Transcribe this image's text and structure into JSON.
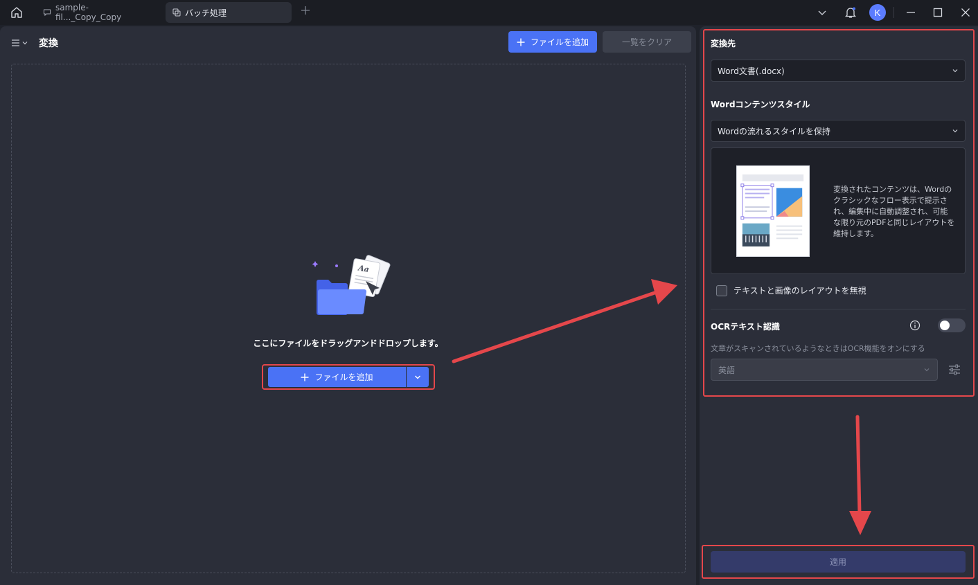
{
  "titlebar": {
    "tabs": [
      {
        "label": "sample-fil..._Copy_Copy"
      },
      {
        "label": "バッチ処理"
      }
    ],
    "avatar_initial": "K"
  },
  "left_panel": {
    "title": "変換",
    "add_file_label": "ファイルを追加",
    "clear_list_label": "一覧をクリア",
    "dropzone_text": "ここにファイルをドラッグアンドドロップします。",
    "dropzone_add_label": "ファイルを追加",
    "illustration_text": "Aa"
  },
  "right_panel": {
    "output_label": "変換先",
    "output_value": "Word文書(.docx)",
    "style_label": "Wordコンテンツスタイル",
    "style_value": "Wordの流れるスタイルを保持",
    "style_description": "変換されたコンテンツは、Wordのクラシックなフロー表示で提示され、編集中に自動調整され、可能な限り元のPDFと同じレイアウトを維持します。",
    "ignore_layout_label": "テキストと画像のレイアウトを無視",
    "ignore_layout_checked": false,
    "ocr_label": "OCRテキスト認識",
    "ocr_enabled": false,
    "ocr_hint": "文章がスキャンされているようなときはOCR機能をオンにする",
    "ocr_language": "英語",
    "apply_label": "適用"
  },
  "colors": {
    "accent": "#4a72f5",
    "annotation": "#e5474b",
    "panel": "#2b2e39",
    "background": "#1f222a"
  }
}
